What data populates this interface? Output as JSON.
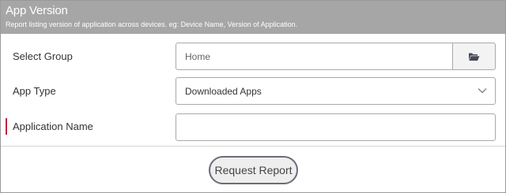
{
  "header": {
    "title": "App Version",
    "subtitle": "Report listing version of application across devices. eg: Device Name, Version of Application."
  },
  "form": {
    "select_group": {
      "label": "Select Group",
      "value": "Home",
      "browse_icon": "folder-open-icon"
    },
    "app_type": {
      "label": "App Type",
      "value": "Downloaded Apps",
      "icon": "chevron-down-icon"
    },
    "application_name": {
      "label": "Application Name",
      "value": "",
      "required": true
    }
  },
  "actions": {
    "request_report": "Request Report"
  },
  "colors": {
    "header_bg": "#a6a6a6",
    "required_mark": "#c0243c",
    "button_border": "#6b6b7a"
  }
}
